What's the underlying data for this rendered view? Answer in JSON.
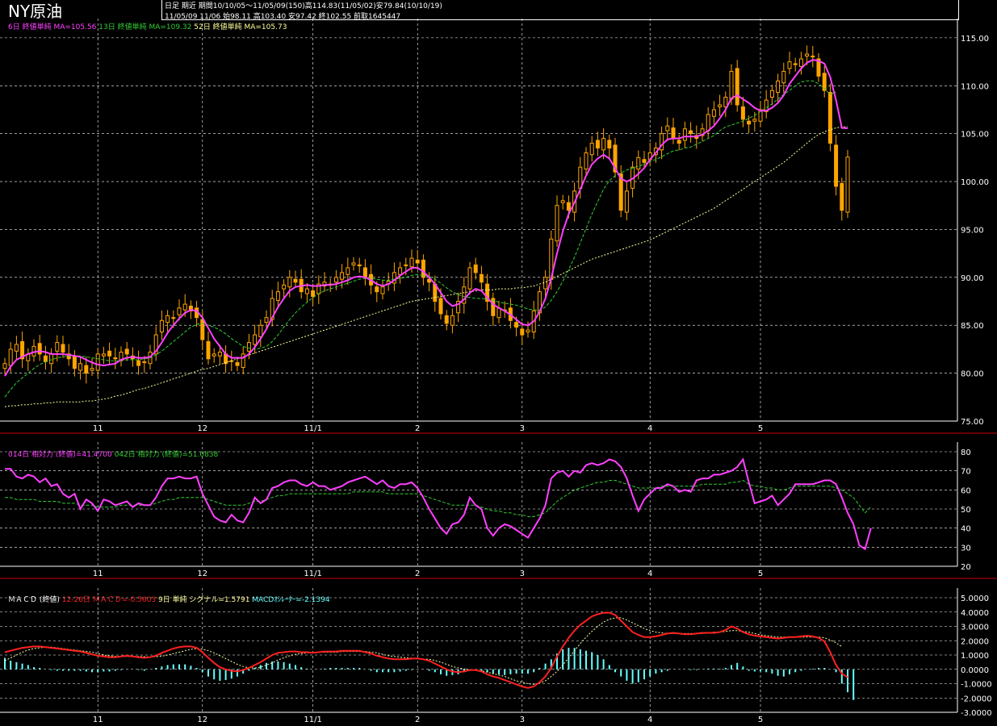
{
  "title": "NY原油",
  "info": {
    "line1": "日足  期近  期間10/10/05～11/05/09(150)高114.83(11/05/02)安79.84(10/10/19)",
    "line2": "11/05/09 11/06 始98.11 高103.40 安97.42 終102.55 前取1645447"
  },
  "colors": {
    "up": "#000000",
    "down": "#ffa500",
    "wick": "#ffa500",
    "ma_short": "#ff40ff",
    "ma_mid": "#33cc33",
    "ma_long": "#ffff99",
    "rsi_short": "#ff40ff",
    "rsi_long": "#33cc33",
    "macd": "#ff2020",
    "signal": "#ffffaa",
    "oscillator": "#66ffff",
    "grid": "#ffffff",
    "axis": "#ffffff"
  },
  "legends": {
    "price": [
      {
        "text": "6日 終値単純 MA=105.56",
        "color": "#ff40ff"
      },
      {
        "text": "13日 終値単純 MA=109.32",
        "color": "#33cc33"
      },
      {
        "text": "52日 終値単純 MA=105.73",
        "color": "#ffff99"
      }
    ],
    "rsi": [
      {
        "text": "014日 相対力 (終値)=41.4700",
        "color": "#ff40ff"
      },
      {
        "text": "042日 相対力 (終値)=51.0838",
        "color": "#33cc33"
      }
    ],
    "macd": [
      {
        "text": "ＭＡＣＤ (終値)",
        "color": "#ffffff"
      },
      {
        "text": "12-26日 ＭＡＣＤ=-0.5603",
        "color": "#ff2020"
      },
      {
        "text": "9日 単純 シグナル=1.5791",
        "color": "#ffff99"
      },
      {
        "text": "MACDｵｼﾚｰﾀｰ=-2.1394",
        "color": "#66ffff"
      }
    ]
  },
  "x_labels": [
    "11",
    "12",
    "11/1",
    "2",
    "3",
    "4",
    "5"
  ],
  "price_ticks": [
    "115.00",
    "110.00",
    "105.00",
    "100.00",
    "95.00",
    "90.00",
    "85.00",
    "80.00",
    "75.00"
  ],
  "rsi_ticks": [
    "80",
    "70",
    "60",
    "50",
    "40",
    "30",
    "20"
  ],
  "macd_ticks": [
    "5.0000",
    "4.0000",
    "3.0000",
    "2.0000",
    "1.0000",
    "0.0000",
    "-1.0000",
    "-2.0000",
    "-3.0000"
  ],
  "chart_data": {
    "type": "candlestick",
    "price_ylim": [
      75,
      116
    ],
    "rsi_ylim": [
      20,
      80
    ],
    "macd_ylim": [
      -3,
      5
    ],
    "closes": [
      81.0,
      82.5,
      83.0,
      81.5,
      82.0,
      82.8,
      82.0,
      81.2,
      82.0,
      83.2,
      82.2,
      81.5,
      80.5,
      81.0,
      80.0,
      80.5,
      82.0,
      82.0,
      81.8,
      81.5,
      82.2,
      82.0,
      81.5,
      80.8,
      81.2,
      82.2,
      84.0,
      85.5,
      86.0,
      85.8,
      86.8,
      87.2,
      86.5,
      85.8,
      83.5,
      81.5,
      82.0,
      82.2,
      81.0,
      81.3,
      80.8,
      82.0,
      83.2,
      84.0,
      85.0,
      85.8,
      87.8,
      88.5,
      89.2,
      90.0,
      89.5,
      88.5,
      88.8,
      88.0,
      89.3,
      89.5,
      89.2,
      90.0,
      90.5,
      91.0,
      91.5,
      91.2,
      90.0,
      89.2,
      88.5,
      89.0,
      89.6,
      90.5,
      91.0,
      91.3,
      92.0,
      91.5,
      90.0,
      89.5,
      87.5,
      86.2,
      85.2,
      86.0,
      87.5,
      89.0,
      91.0,
      90.5,
      89.5,
      87.5,
      86.0,
      86.8,
      86.5,
      85.5,
      84.8,
      84.0,
      84.5,
      86.5,
      88.5,
      90.0,
      94.0,
      97.5,
      98.0,
      97.0,
      99.0,
      101.5,
      103.0,
      104.0,
      103.5,
      104.5,
      103.5,
      101.0,
      97.0,
      99.0,
      101.5,
      102.5,
      102.0,
      103.0,
      103.5,
      105.0,
      105.8,
      104.5,
      104.0,
      105.5,
      105.0,
      104.5,
      105.5,
      107.0,
      107.5,
      108.0,
      108.8,
      111.5,
      108.0,
      106.5,
      106.0,
      106.5,
      107.5,
      108.5,
      109.5,
      110.5,
      111.5,
      112.5,
      112.2,
      112.8,
      113.3,
      113.0,
      111.0,
      109.5,
      104.0,
      99.5,
      97.0,
      102.55
    ],
    "x_ticks_index": [
      16,
      34,
      53,
      71,
      89,
      111,
      130
    ],
    "ma_short": [
      79.7,
      80.7,
      81.4,
      81.7,
      82.0,
      82.2,
      82.3,
      82.2,
      82.0,
      82.0,
      82.0,
      81.9,
      81.8,
      81.7,
      81.4,
      81.1,
      80.9,
      80.8,
      80.9,
      81.0,
      81.4,
      81.6,
      81.7,
      81.6,
      81.6,
      81.7,
      82.3,
      83.2,
      84.2,
      85.0,
      85.7,
      86.3,
      86.6,
      86.5,
      85.8,
      84.7,
      83.6,
      82.8,
      82.0,
      81.6,
      81.6,
      81.6,
      82.0,
      82.7,
      83.6,
      84.6,
      85.8,
      86.9,
      87.8,
      88.6,
      89.0,
      89.1,
      89.2,
      89.1,
      89.1,
      89.2,
      89.2,
      89.3,
      89.5,
      89.7,
      90.0,
      90.1,
      90.0,
      89.7,
      89.3,
      89.1,
      89.3,
      89.7,
      90.2,
      90.6,
      91.0,
      91.0,
      90.6,
      90.0,
      89.3,
      88.4,
      87.5,
      87.0,
      87.2,
      87.7,
      88.4,
      88.8,
      88.6,
      87.9,
      87.2,
      86.8,
      86.5,
      86.1,
      85.6,
      85.1,
      85.0,
      85.4,
      86.4,
      87.8,
      89.9,
      92.5,
      94.8,
      96.6,
      97.8,
      99.2,
      100.6,
      101.8,
      102.4,
      102.8,
      102.4,
      101.4,
      100.3,
      100.0,
      100.3,
      100.8,
      101.4,
      102.3,
      103.0,
      103.8,
      104.4,
      104.5,
      104.5,
      104.7,
      104.7,
      104.7,
      104.9,
      105.3,
      105.8,
      106.6,
      107.5,
      108.7,
      109.0,
      108.6,
      108.2,
      107.7,
      107.4,
      107.4,
      107.7,
      108.2,
      109.0,
      110.2,
      111.0,
      111.8,
      112.4,
      112.7,
      112.6,
      112.3,
      110.9,
      108.5,
      105.6,
      105.56
    ],
    "ma_mid": [
      77.5,
      78.3,
      79.0,
      79.5,
      80.0,
      80.5,
      80.9,
      81.2,
      81.4,
      81.6,
      81.7,
      81.8,
      81.8,
      81.8,
      81.7,
      81.6,
      81.5,
      81.4,
      81.3,
      81.3,
      81.3,
      81.4,
      81.4,
      81.4,
      81.5,
      81.6,
      81.9,
      82.3,
      82.8,
      83.3,
      83.8,
      84.3,
      84.8,
      85.1,
      85.2,
      85.0,
      84.8,
      84.5,
      84.1,
      83.6,
      83.2,
      82.8,
      82.6,
      82.5,
      82.6,
      82.8,
      83.3,
      84.0,
      84.8,
      85.6,
      86.3,
      86.9,
      87.4,
      87.9,
      88.3,
      88.6,
      88.8,
      89.0,
      89.2,
      89.4,
      89.6,
      89.8,
      89.9,
      89.9,
      89.8,
      89.7,
      89.7,
      89.8,
      89.9,
      90.0,
      90.2,
      90.3,
      90.2,
      90.1,
      89.8,
      89.4,
      88.9,
      88.5,
      88.2,
      88.0,
      87.9,
      87.8,
      87.8,
      87.7,
      87.6,
      87.4,
      87.3,
      87.2,
      87.1,
      86.9,
      86.7,
      86.6,
      86.6,
      86.9,
      87.6,
      88.5,
      89.6,
      90.8,
      92.1,
      93.6,
      95.1,
      96.6,
      97.9,
      99.2,
      100.1,
      100.6,
      100.9,
      101.2,
      101.4,
      101.6,
      101.8,
      102.1,
      102.3,
      102.6,
      102.9,
      103.2,
      103.3,
      103.5,
      103.6,
      103.9,
      104.2,
      104.5,
      104.8,
      105.3,
      105.7,
      105.9,
      106.1,
      106.3,
      106.6,
      106.9,
      107.3,
      107.7,
      108.1,
      108.6,
      109.1,
      109.5,
      110.0,
      110.4,
      110.5,
      110.5,
      110.2,
      109.7,
      109.1,
      109.32
    ],
    "ma_long": [
      76.5,
      76.6,
      76.6,
      76.7,
      76.7,
      76.8,
      76.8,
      76.9,
      76.9,
      77.0,
      77.0,
      77.0,
      77.0,
      77.0,
      77.1,
      77.1,
      77.2,
      77.3,
      77.4,
      77.6,
      77.7,
      77.9,
      78.1,
      78.3,
      78.4,
      78.6,
      78.8,
      79.0,
      79.2,
      79.4,
      79.6,
      79.8,
      80.0,
      80.2,
      80.4,
      80.5,
      80.7,
      80.9,
      81.1,
      81.3,
      81.5,
      81.7,
      81.9,
      82.1,
      82.3,
      82.5,
      82.7,
      82.9,
      83.1,
      83.3,
      83.5,
      83.7,
      83.9,
      84.1,
      84.3,
      84.5,
      84.7,
      84.9,
      85.1,
      85.3,
      85.5,
      85.7,
      85.9,
      86.1,
      86.3,
      86.5,
      86.7,
      86.9,
      87.1,
      87.3,
      87.5,
      87.6,
      87.7,
      87.8,
      87.9,
      88.0,
      88.1,
      88.2,
      88.3,
      88.4,
      88.5,
      88.6,
      88.7,
      88.7,
      88.7,
      88.8,
      88.8,
      88.8,
      88.9,
      88.9,
      89.0,
      89.1,
      89.3,
      89.5,
      89.8,
      90.1,
      90.4,
      90.7,
      91.0,
      91.3,
      91.6,
      91.9,
      92.1,
      92.3,
      92.5,
      92.7,
      92.9,
      93.1,
      93.3,
      93.5,
      93.7,
      93.9,
      94.2,
      94.5,
      94.8,
      95.1,
      95.4,
      95.7,
      96.0,
      96.3,
      96.6,
      96.9,
      97.2,
      97.6,
      98.0,
      98.4,
      98.8,
      99.2,
      99.6,
      100.0,
      100.4,
      100.8,
      101.2,
      101.6,
      102.0,
      102.5,
      103.0,
      103.5,
      104.0,
      104.5,
      104.9,
      105.2,
      105.4,
      105.6,
      105.7,
      105.73
    ],
    "rsi_short": [
      71,
      71,
      67,
      66,
      68,
      67,
      64,
      66,
      62,
      63,
      58,
      56,
      58,
      50,
      55,
      53,
      49,
      55,
      54,
      52,
      53,
      54,
      51,
      53,
      52,
      52,
      56,
      62,
      66,
      66,
      67,
      66,
      66,
      67,
      58,
      52,
      46,
      44,
      43,
      47,
      44,
      43,
      48,
      56,
      53,
      55,
      61,
      62,
      64,
      65,
      65,
      63,
      62,
      64,
      62,
      62,
      60,
      61,
      62,
      64,
      65,
      66,
      67,
      65,
      63,
      65,
      62,
      61,
      63,
      63,
      64,
      61,
      56,
      50,
      45,
      40,
      37,
      42,
      43,
      47,
      56,
      52,
      50,
      40,
      36,
      40,
      42,
      41,
      39,
      37,
      35,
      40,
      45,
      52,
      66,
      69,
      70,
      67,
      70,
      69,
      73,
      74,
      73,
      74,
      76,
      75,
      72,
      66,
      57,
      49,
      55,
      58,
      61,
      61,
      63,
      62,
      59,
      60,
      59,
      65,
      66,
      66,
      68,
      68,
      69,
      70,
      72,
      76,
      64,
      53,
      54,
      55,
      57,
      52,
      55,
      58,
      63,
      63,
      63,
      63,
      64,
      65,
      65,
      63,
      56,
      48,
      42,
      31,
      29,
      40
    ],
    "rsi_long": [
      56,
      56,
      55,
      55,
      55,
      55,
      54,
      54,
      54,
      54,
      53,
      53,
      53,
      52,
      52,
      52,
      51,
      51,
      51,
      51,
      52,
      52,
      52,
      52,
      52,
      52,
      53,
      54,
      55,
      55,
      56,
      56,
      56,
      56,
      56,
      55,
      54,
      53,
      52,
      52,
      52,
      52,
      53,
      54,
      54,
      55,
      56,
      57,
      57,
      58,
      58,
      58,
      58,
      58,
      58,
      58,
      58,
      58,
      58,
      58,
      59,
      59,
      59,
      59,
      59,
      59,
      58,
      58,
      58,
      58,
      58,
      58,
      57,
      56,
      55,
      54,
      53,
      52,
      52,
      52,
      52,
      52,
      51,
      50,
      49,
      49,
      48,
      48,
      47,
      47,
      46,
      46,
      47,
      48,
      51,
      54,
      56,
      58,
      60,
      61,
      62,
      63,
      64,
      64,
      65,
      65,
      64,
      63,
      62,
      61,
      61,
      61,
      61,
      62,
      62,
      62,
      62,
      62,
      62,
      62,
      63,
      63,
      63,
      63,
      63,
      64,
      64,
      65,
      63,
      62,
      62,
      61,
      61,
      60,
      60,
      61,
      62,
      62,
      62,
      62,
      62,
      62,
      62,
      61,
      60,
      58,
      56,
      52,
      48,
      51.08
    ],
    "macd": [
      1.2,
      1.3,
      1.4,
      1.5,
      1.55,
      1.6,
      1.6,
      1.55,
      1.5,
      1.45,
      1.4,
      1.35,
      1.3,
      1.25,
      1.15,
      1.05,
      0.95,
      0.9,
      0.85,
      0.85,
      0.9,
      0.95,
      0.9,
      0.85,
      0.8,
      0.85,
      0.95,
      1.15,
      1.3,
      1.45,
      1.55,
      1.6,
      1.6,
      1.5,
      1.2,
      0.8,
      0.45,
      0.15,
      0.0,
      -0.1,
      -0.15,
      -0.05,
      0.1,
      0.3,
      0.5,
      0.75,
      1.0,
      1.15,
      1.2,
      1.25,
      1.25,
      1.2,
      1.2,
      1.15,
      1.2,
      1.25,
      1.25,
      1.25,
      1.3,
      1.3,
      1.3,
      1.3,
      1.2,
      1.1,
      0.95,
      0.85,
      0.75,
      0.7,
      0.7,
      0.7,
      0.75,
      0.75,
      0.7,
      0.6,
      0.4,
      0.2,
      0.0,
      -0.15,
      -0.2,
      -0.15,
      -0.05,
      -0.05,
      -0.15,
      -0.35,
      -0.5,
      -0.6,
      -0.75,
      -0.9,
      -1.05,
      -1.2,
      -1.3,
      -1.2,
      -0.9,
      -0.5,
      0.1,
      0.9,
      1.6,
      2.2,
      2.7,
      3.1,
      3.4,
      3.7,
      3.85,
      3.95,
      3.95,
      3.8,
      3.4,
      3.0,
      2.6,
      2.4,
      2.25,
      2.25,
      2.3,
      2.4,
      2.5,
      2.55,
      2.5,
      2.45,
      2.45,
      2.5,
      2.55,
      2.55,
      2.55,
      2.6,
      2.75,
      3.0,
      2.85,
      2.6,
      2.45,
      2.35,
      2.3,
      2.25,
      2.2,
      2.15,
      2.2,
      2.25,
      2.25,
      2.3,
      2.35,
      2.3,
      2.2,
      1.95,
      1.2,
      0.3,
      -0.3,
      -0.56
    ],
    "signal": [
      0.6,
      0.8,
      1.0,
      1.2,
      1.35,
      1.45,
      1.5,
      1.55,
      1.55,
      1.5,
      1.45,
      1.4,
      1.35,
      1.3,
      1.25,
      1.2,
      1.1,
      1.0,
      0.95,
      0.9,
      0.9,
      0.9,
      0.9,
      0.9,
      0.88,
      0.86,
      0.88,
      0.92,
      1.0,
      1.1,
      1.2,
      1.3,
      1.4,
      1.45,
      1.4,
      1.3,
      1.15,
      0.95,
      0.75,
      0.55,
      0.35,
      0.2,
      0.1,
      0.1,
      0.15,
      0.3,
      0.45,
      0.65,
      0.8,
      0.95,
      1.05,
      1.1,
      1.15,
      1.15,
      1.2,
      1.2,
      1.2,
      1.2,
      1.25,
      1.25,
      1.25,
      1.25,
      1.25,
      1.2,
      1.15,
      1.05,
      0.95,
      0.9,
      0.85,
      0.8,
      0.78,
      0.75,
      0.72,
      0.7,
      0.62,
      0.5,
      0.35,
      0.2,
      0.1,
      0.02,
      -0.02,
      -0.05,
      -0.1,
      -0.2,
      -0.3,
      -0.4,
      -0.5,
      -0.65,
      -0.8,
      -0.9,
      -1.0,
      -1.05,
      -0.95,
      -0.8,
      -0.5,
      -0.15,
      0.3,
      0.8,
      1.3,
      1.8,
      2.25,
      2.65,
      3.0,
      3.3,
      3.5,
      3.6,
      3.6,
      3.45,
      3.25,
      3.05,
      2.85,
      2.7,
      2.6,
      2.55,
      2.5,
      2.5,
      2.5,
      2.5,
      2.5,
      2.5,
      2.5,
      2.55,
      2.6,
      2.6,
      2.65,
      2.7,
      2.7,
      2.65,
      2.6,
      2.5,
      2.4,
      2.35,
      2.3,
      2.25,
      2.25,
      2.25,
      2.25,
      2.25,
      2.25,
      2.25,
      2.25,
      2.2,
      2.05,
      1.85,
      1.58
    ],
    "oscillator": [
      0.8,
      0.6,
      0.5,
      0.4,
      0.3,
      0.15,
      0.1,
      0.0,
      -0.05,
      -0.1,
      -0.1,
      -0.1,
      -0.1,
      -0.1,
      -0.15,
      -0.2,
      -0.2,
      -0.15,
      -0.15,
      -0.1,
      -0.05,
      0.0,
      0.0,
      -0.05,
      -0.1,
      0.0,
      0.1,
      0.2,
      0.3,
      0.35,
      0.35,
      0.35,
      0.25,
      0.1,
      -0.2,
      -0.5,
      -0.7,
      -0.8,
      -0.75,
      -0.65,
      -0.5,
      -0.3,
      -0.1,
      0.1,
      0.3,
      0.45,
      0.55,
      0.55,
      0.5,
      0.4,
      0.3,
      0.15,
      0.05,
      0.0,
      0.0,
      0.05,
      0.1,
      0.1,
      0.1,
      0.1,
      0.1,
      0.1,
      0.0,
      -0.1,
      -0.2,
      -0.2,
      -0.2,
      -0.2,
      -0.15,
      -0.1,
      -0.05,
      0.0,
      0.0,
      -0.1,
      -0.2,
      -0.35,
      -0.45,
      -0.4,
      -0.35,
      -0.2,
      -0.1,
      -0.05,
      -0.1,
      -0.2,
      -0.3,
      -0.35,
      -0.4,
      -0.35,
      -0.3,
      -0.3,
      -0.3,
      -0.2,
      0.1,
      0.4,
      0.7,
      1.1,
      1.4,
      1.5,
      1.5,
      1.4,
      1.3,
      1.2,
      1.0,
      0.7,
      0.3,
      -0.2,
      -0.5,
      -0.8,
      -1.0,
      -0.9,
      -0.7,
      -0.5,
      -0.3,
      -0.2,
      -0.1,
      0.0,
      0.0,
      0.0,
      -0.05,
      -0.05,
      0.0,
      0.05,
      0.05,
      0.05,
      0.1,
      0.3,
      0.45,
      0.2,
      -0.1,
      -0.15,
      -0.15,
      -0.2,
      -0.3,
      -0.45,
      -0.5,
      -0.35,
      -0.2,
      -0.1,
      0.0,
      0.05,
      0.1,
      0.1,
      0.0,
      -0.2,
      -1.0,
      -1.6,
      -2.14
    ]
  }
}
